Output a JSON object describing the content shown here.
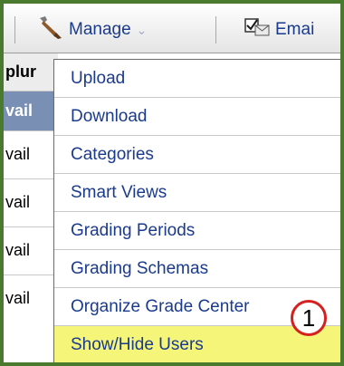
{
  "toolbar": {
    "manage": {
      "label": "Manage",
      "icon": "wrench-icon"
    },
    "email": {
      "label": "Emai",
      "icon": "email-icon"
    }
  },
  "left_column": [
    "plur",
    "vail",
    "vail",
    "vail",
    "vail",
    "vail"
  ],
  "menu": {
    "items": [
      {
        "label": "Upload"
      },
      {
        "label": "Download"
      },
      {
        "label": "Categories"
      },
      {
        "label": "Smart Views"
      },
      {
        "label": "Grading Periods"
      },
      {
        "label": "Grading Schemas"
      },
      {
        "label": "Organize Grade Center"
      },
      {
        "label": "Show/Hide Users",
        "highlighted": true
      }
    ]
  },
  "callout": {
    "number": "1"
  },
  "colors": {
    "frame": "#4a7a2e",
    "highlight": "#f5f57a",
    "link_text": "#1a3a8c",
    "callout_border": "#d62020"
  }
}
